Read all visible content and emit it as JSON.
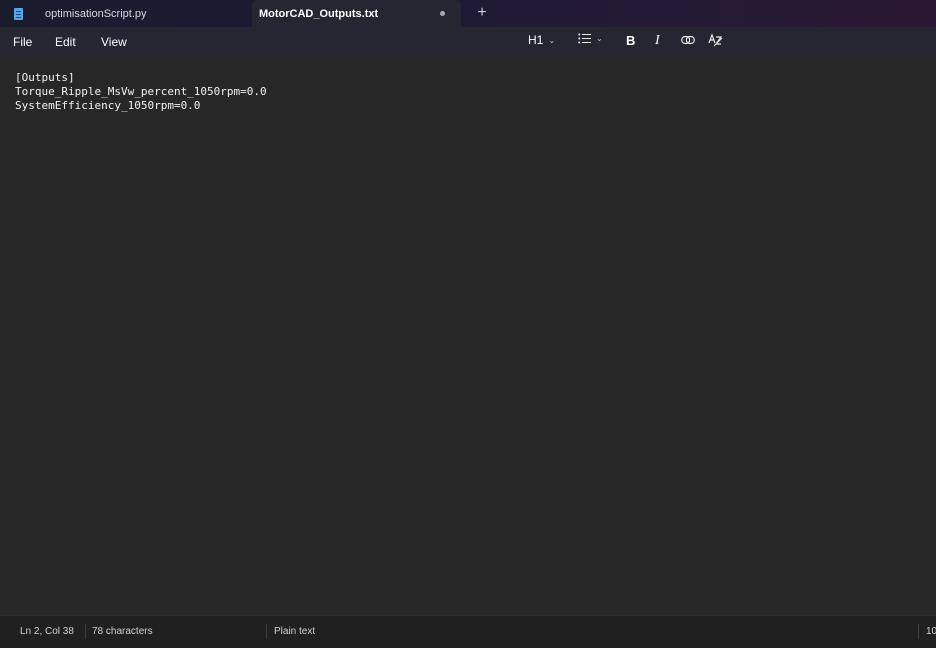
{
  "tabs": [
    {
      "label": "optimisationScript.py",
      "active": false
    },
    {
      "label": "MotorCAD_Outputs.txt",
      "active": true,
      "unsaved_dot": "●"
    }
  ],
  "new_tab_symbol": "+",
  "menu": {
    "file": "File",
    "edit": "Edit",
    "view": "View"
  },
  "format_toolbar": {
    "heading": "H1",
    "heading_chevron": "⌄",
    "list_chevron": "⌄",
    "bold": "B",
    "italic": "I"
  },
  "editor": {
    "lines": [
      "[Outputs]",
      "Torque_Ripple_MsVw_percent_1050rpm=0.0",
      "SystemEfficiency_1050rpm=0.0"
    ]
  },
  "status": {
    "position": "Ln 2, Col 38",
    "characters": "78 characters",
    "file_type": "Plain text",
    "zoom": "10"
  },
  "colors": {
    "tab_bar_gradient_start": "#1b1b2e",
    "tab_bar_gradient_end": "#2a1832",
    "active_tab": "#262633",
    "editor_bg": "#272727",
    "status_bg": "#202020",
    "notepad_icon": "#5aa7e8"
  }
}
